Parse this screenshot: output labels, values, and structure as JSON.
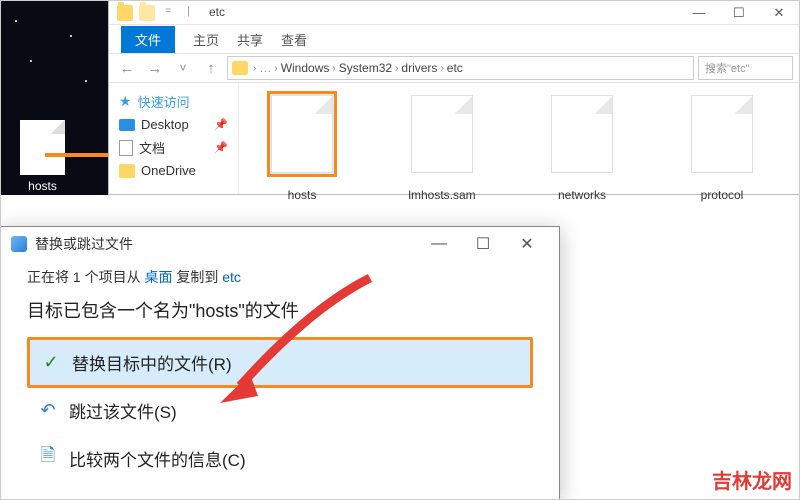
{
  "desktop": {
    "file_label": "hosts"
  },
  "explorer": {
    "title_label": "etc",
    "tabs": {
      "file": "文件",
      "home": "主页",
      "share": "共享",
      "view": "查看"
    },
    "breadcrumbs": [
      "Windows",
      "System32",
      "drivers",
      "etc"
    ],
    "search_placeholder": "搜索\"etc\"",
    "sidebar": {
      "quick_access": "快速访问",
      "items": [
        {
          "label": "Desktop"
        },
        {
          "label": "文档"
        },
        {
          "label": "OneDrive"
        }
      ]
    },
    "files": [
      {
        "name": "hosts",
        "selected": true
      },
      {
        "name": "lmhosts.sam",
        "selected": false
      },
      {
        "name": "networks",
        "selected": false
      },
      {
        "name": "protocol",
        "selected": false
      }
    ]
  },
  "dialog": {
    "title": "替换或跳过文件",
    "line1_prefix": "正在将 1 个项目从 ",
    "line1_src": "桌面",
    "line1_mid": " 复制到 ",
    "line1_dst": "etc",
    "message": "目标已包含一个名为\"hosts\"的文件",
    "options": [
      {
        "label": "替换目标中的文件(R)",
        "selected": true,
        "icon": "check"
      },
      {
        "label": "跳过该文件(S)",
        "selected": false,
        "icon": "undo"
      },
      {
        "label": "比较两个文件的信息(C)",
        "selected": false,
        "icon": "compare"
      }
    ]
  },
  "watermark": "吉林龙网"
}
